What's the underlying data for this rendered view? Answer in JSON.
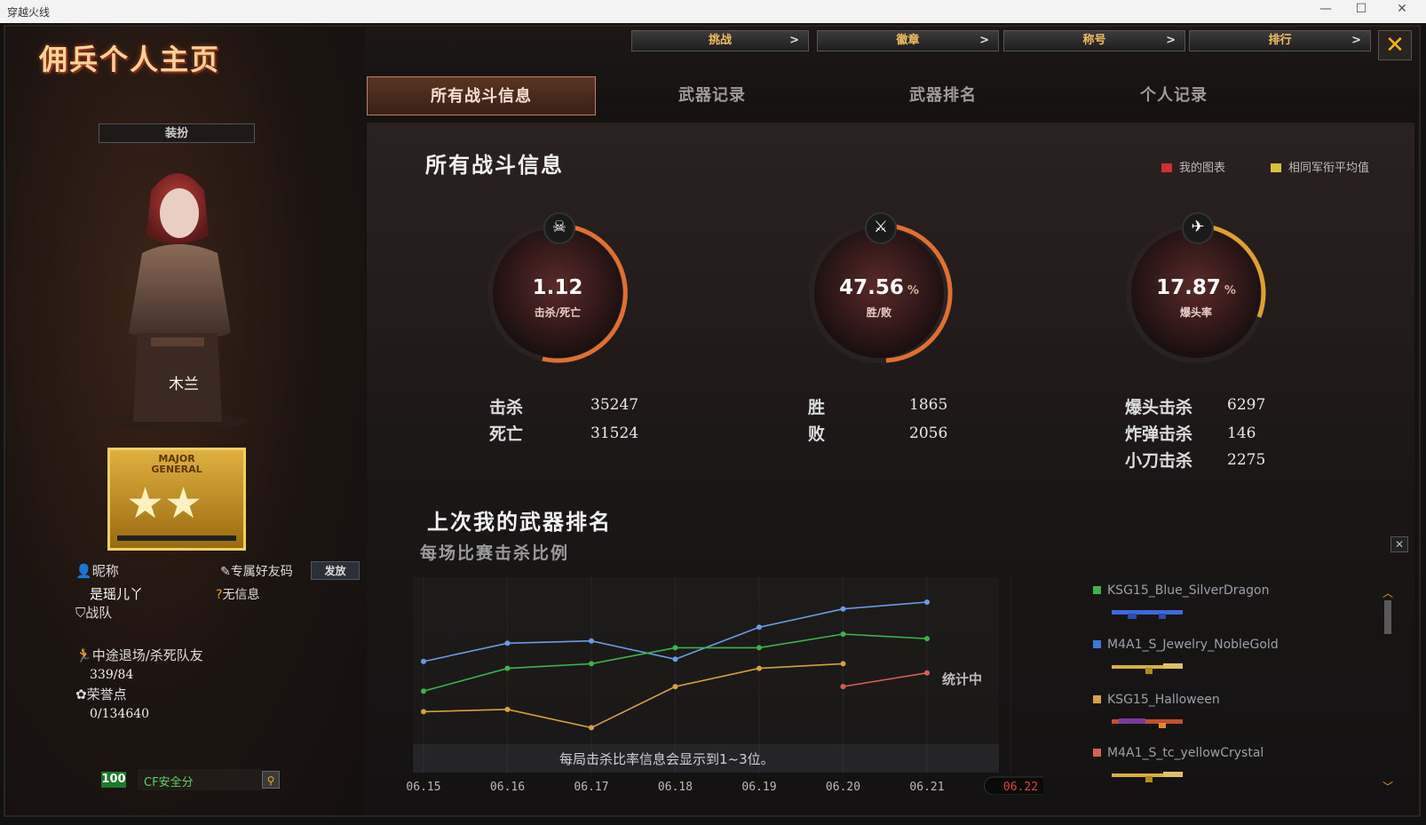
{
  "window": {
    "title": "穿越火线",
    "minimize": "—",
    "maximize": "☐",
    "close": "✕"
  },
  "page_title": "佣兵个人主页",
  "topnav": [
    {
      "label": "挑战",
      "arrow": ">"
    },
    {
      "label": "徽章",
      "arrow": ">"
    },
    {
      "label": "称号",
      "arrow": ">"
    },
    {
      "label": "排行",
      "arrow": ">"
    }
  ],
  "close_label": "✕",
  "tabs": [
    "所有战斗信息",
    "武器记录",
    "武器排名",
    "个人记录"
  ],
  "dress_button": "装扮",
  "character_name": "木兰",
  "rank_badge": {
    "line1": "MAJOR",
    "line2": "GENERAL"
  },
  "profile": {
    "nickname_label": "昵称",
    "nickname": "是瑶儿丫",
    "friend_code_label": "专属好友码",
    "send_button": "发放",
    "friend_code_value": "无信息",
    "clan_label": "战队",
    "quit_label": "中途退场/杀死队友",
    "quit_value": "339/84",
    "honor_label": "荣誉点",
    "honor_value": "0/134640",
    "security_score": "100",
    "security_label": "CF安全分"
  },
  "section_title": "所有战斗信息",
  "legend": {
    "mine": "我的图表",
    "avg": "相同军衔平均值",
    "mine_color": "#d03030",
    "avg_color": "#d8c040"
  },
  "gauges": [
    {
      "value": "1.12",
      "unit": "",
      "label": "击杀/死亡",
      "icon": "☠"
    },
    {
      "value": "47.56",
      "unit": "%",
      "label": "胜/败",
      "icon": "⚔"
    },
    {
      "value": "17.87",
      "unit": "%",
      "label": "爆头率",
      "icon": "✈"
    }
  ],
  "stats": {
    "kills_label": "击杀",
    "kills": "35247",
    "deaths_label": "死亡",
    "deaths": "31524",
    "wins_label": "胜",
    "wins": "1865",
    "losses_label": "败",
    "losses": "2056",
    "headshot_label": "爆头击杀",
    "headshot": "6297",
    "bomb_label": "炸弹击杀",
    "bomb": "146",
    "knife_label": "小刀击杀",
    "knife": "2275"
  },
  "weapon_rank_title": "上次我的武器排名",
  "chart_subtitle": "每场比赛击杀比例",
  "chart_status": "统计中",
  "chart_note": "每局击杀比率信息会显示到1~3位。",
  "weapons": [
    {
      "name": "KSG15_Blue_SilverDragon",
      "color": "#3cb44a"
    },
    {
      "name": "M4A1_S_Jewelry_NobleGold",
      "color": "#3c78d8"
    },
    {
      "name": "KSG15_Halloween",
      "color": "#d8a040"
    },
    {
      "name": "M4A1_S_tc_yellowCrystal",
      "color": "#d86050"
    }
  ],
  "chart_data": {
    "type": "line",
    "x": [
      "06.15",
      "06.16",
      "06.17",
      "06.18",
      "06.19",
      "06.20",
      "06.21",
      "06.22"
    ],
    "selected_x": "06.22",
    "series": [
      {
        "values": [
          1.7,
          2.5,
          2.6,
          1.8,
          3.2,
          4.0,
          4.3,
          null
        ],
        "color": "#6a9ae8"
      },
      {
        "values": [
          0.4,
          1.4,
          1.6,
          2.3,
          2.3,
          2.9,
          2.7,
          null
        ],
        "color": "#3cb44a"
      },
      {
        "values": [
          -0.5,
          -0.4,
          -1.2,
          0.6,
          1.4,
          1.6,
          null,
          null
        ],
        "color": "#d8a040"
      },
      {
        "values": [
          null,
          null,
          null,
          null,
          null,
          0.6,
          1.2,
          null
        ],
        "color": "#d86050"
      }
    ],
    "ylim": [
      -2,
      5
    ]
  }
}
